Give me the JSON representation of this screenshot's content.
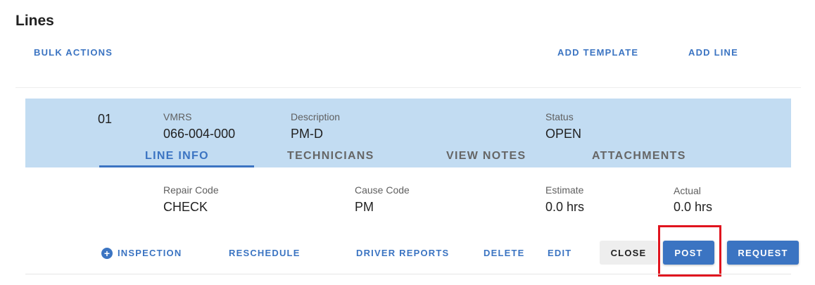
{
  "section": {
    "title": "Lines"
  },
  "toolbar": {
    "bulk_actions": "BULK ACTIONS",
    "add_template": "ADD TEMPLATE",
    "add_line": "ADD LINE"
  },
  "line": {
    "number": "01",
    "vmrs": {
      "label": "VMRS",
      "value": "066-004-000"
    },
    "description": {
      "label": "Description",
      "value": "PM-D"
    },
    "status": {
      "label": "Status",
      "value": "OPEN"
    },
    "tabs": [
      {
        "label": "LINE INFO",
        "active": true
      },
      {
        "label": "TECHNICIANS",
        "active": false
      },
      {
        "label": "VIEW NOTES",
        "active": false
      },
      {
        "label": "ATTACHMENTS",
        "active": false
      }
    ],
    "info": {
      "repair_code": {
        "label": "Repair Code",
        "value": "CHECK"
      },
      "cause_code": {
        "label": "Cause Code",
        "value": "PM"
      },
      "estimate": {
        "label": "Estimate",
        "value": "0.0 hrs"
      },
      "actual": {
        "label": "Actual",
        "value": "0.0 hrs"
      }
    },
    "actions": {
      "inspection": "INSPECTION",
      "reschedule": "RESCHEDULE",
      "driver_reports": "DRIVER REPORTS",
      "delete": "DELETE",
      "edit": "EDIT",
      "close": "CLOSE",
      "post": "POST",
      "request": "REQUEST"
    }
  },
  "icons": {
    "inspection": "plus-circle-icon"
  },
  "colors": {
    "accent": "#3b74c2",
    "header_bg": "#c2dcf2",
    "highlight": "#e0141e"
  }
}
